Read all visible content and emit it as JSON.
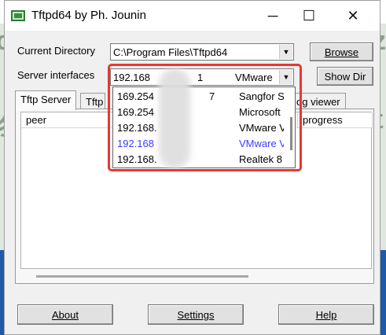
{
  "window": {
    "title": "Tftpd64 by Ph. Jounin",
    "controls": {
      "minimize": "─",
      "maximize": "☐",
      "close": "✕"
    }
  },
  "background": {
    "glyph_left": "c",
    "glyph_right": "z",
    "glyph_left2": "终",
    "glyph_right2": "t"
  },
  "current_directory": {
    "label": "Current Directory",
    "value": "C:\\Program Files\\Tftpd64",
    "browse_button": "Browse"
  },
  "server_interfaces": {
    "label": "Server interfaces",
    "selected_ip": "192.168",
    "selected_ip_tail": "1",
    "selected_name": "VMware",
    "show_dir_button": "Show Dir",
    "options": [
      {
        "ip": "169.254",
        "ip_tail": "7",
        "name": "Sangfor S"
      },
      {
        "ip": "169.254",
        "ip_tail": "",
        "name": "Microsoft"
      },
      {
        "ip": "192.168.",
        "ip_tail": "",
        "name": "VMware V"
      },
      {
        "ip": "192.168",
        "ip_tail": "",
        "name": "VMware V"
      },
      {
        "ip": "192.168.",
        "ip_tail": "",
        "name": "Realtek 8"
      }
    ]
  },
  "tabs": [
    {
      "label": "Tftp Server"
    },
    {
      "label": "Tftp"
    },
    {
      "label": "og viewer"
    }
  ],
  "table": {
    "columns": [
      "peer",
      "progress"
    ]
  },
  "bottom_buttons": {
    "about": "About",
    "settings": "Settings",
    "help": "Help"
  },
  "colors": {
    "highlight_border": "#e53935",
    "hover_text": "#3c3cff",
    "desktop_blue": "#1f5aa8"
  }
}
